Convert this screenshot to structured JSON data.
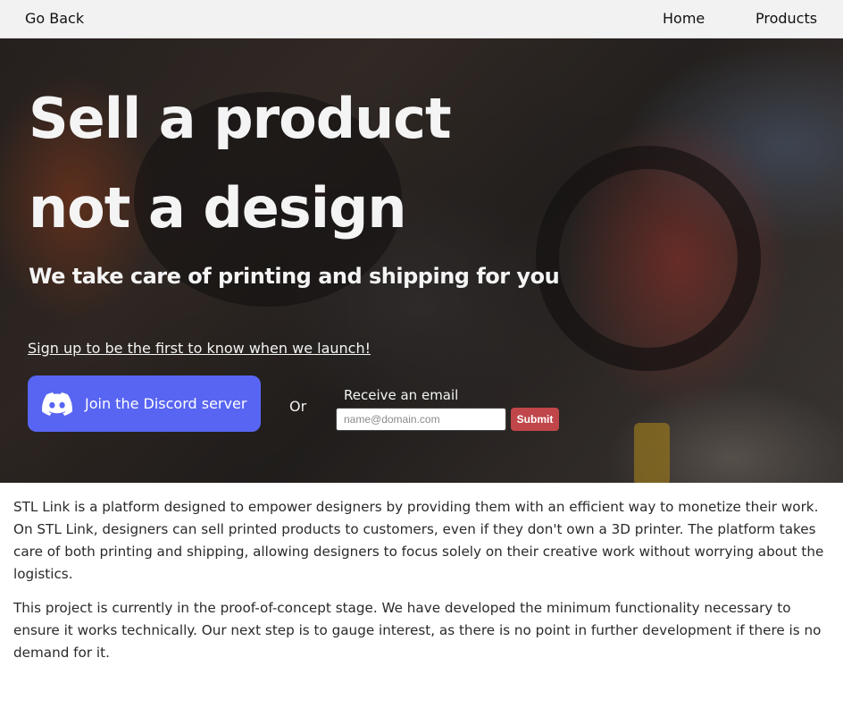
{
  "nav": {
    "go_back": "Go Back",
    "home": "Home",
    "products": "Products"
  },
  "hero": {
    "headline_line1": "Sell a product",
    "headline_line2": "not a design",
    "subhead": "We take care of printing and shipping for you",
    "signup_link": "Sign up to be the first to know when we launch!",
    "discord_button": "Join the Discord server",
    "discord_icon": "discord-icon",
    "or": "Or",
    "email_label": "Receive an email",
    "email_placeholder": "name@domain.com",
    "submit": "Submit"
  },
  "content": {
    "paragraph1": "STL Link is a platform designed to empower designers by providing them with an efficient way to monetize their work. On STL Link, designers can sell printed products to customers, even if they don't own a 3D printer. The platform takes care of both printing and shipping, allowing designers to focus solely on their creative work without worrying about the logistics.",
    "paragraph2": "This project is currently in the proof-of-concept stage. We have developed the minimum functionality necessary to ensure it works technically. Our next step is to gauge interest, as there is no point in further development if there is no demand for it."
  },
  "colors": {
    "discord": "#5865f2",
    "submit": "#c0464a",
    "topbar": "#f2f2f2"
  }
}
